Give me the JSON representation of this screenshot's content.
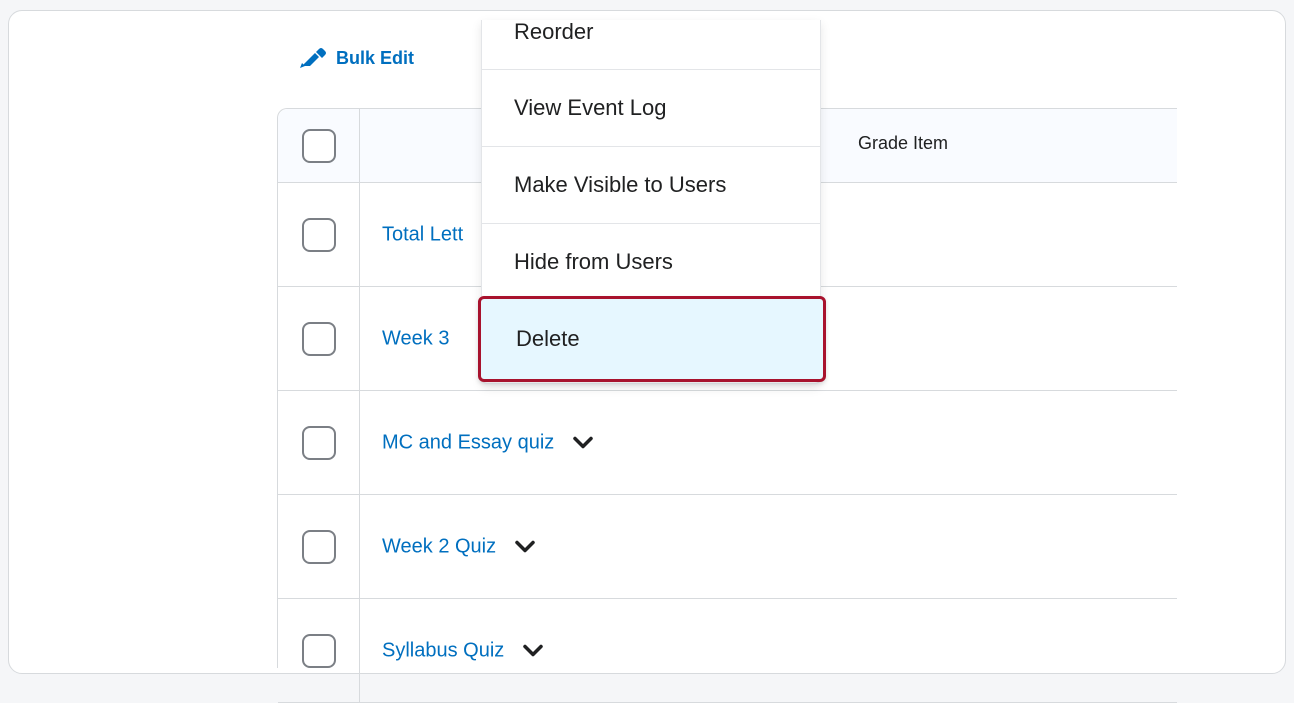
{
  "toolbar": {
    "bulk_edit_label": "Bulk Edit"
  },
  "table": {
    "header": {
      "grade_item_label": "Grade Item"
    },
    "rows": [
      {
        "label": "Total Lett"
      },
      {
        "label": "Week 3"
      },
      {
        "label": "MC and Essay quiz"
      },
      {
        "label": "Week 2 Quiz"
      },
      {
        "label": "Syllabus Quiz"
      }
    ]
  },
  "context_menu": {
    "items": [
      {
        "label": "Reorder"
      },
      {
        "label": "View Event Log"
      },
      {
        "label": "Make Visible to Users"
      },
      {
        "label": "Hide from Users"
      },
      {
        "label": "Delete"
      }
    ],
    "highlight_color": "#a8122d",
    "selected_background": "#e6f7ff"
  },
  "colors": {
    "link": "#006fbf",
    "border": "#d7dadd",
    "text": "#202122"
  },
  "icons": {
    "bulk_edit": "pencil-edit-icon",
    "row_expand": "chevron-down-icon"
  }
}
